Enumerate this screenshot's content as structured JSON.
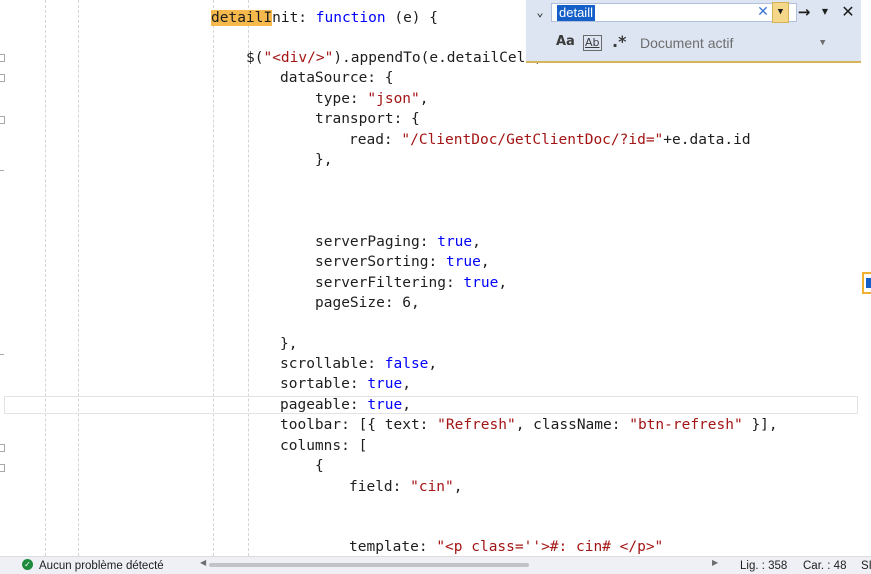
{
  "editor": {
    "lines": [
      {
        "indent": 0,
        "tokens": [
          {
            "t": "detailI",
            "c": "hl"
          },
          {
            "t": "nit: "
          },
          {
            "t": "function",
            "c": "kw"
          },
          {
            "t": " (e) {"
          }
        ]
      },
      {
        "indent": 1,
        "tokens": [
          {
            "t": "$("
          },
          {
            "t": "\"<div/>\"",
            "c": "str"
          },
          {
            "t": ").appendTo(e.detailCell)"
          }
        ]
      },
      {
        "indent": 2,
        "tokens": [
          {
            "t": "dataSource: {"
          }
        ]
      },
      {
        "indent": 3,
        "tokens": [
          {
            "t": "type: "
          },
          {
            "t": "\"json\"",
            "c": "str"
          },
          {
            "t": ","
          }
        ]
      },
      {
        "indent": 3,
        "tokens": [
          {
            "t": "transport: {"
          }
        ]
      },
      {
        "indent": 4,
        "tokens": [
          {
            "t": "read: "
          },
          {
            "t": "\"/ClientDoc/GetClientDoc/?id=\"",
            "c": "str"
          },
          {
            "t": "+e.data.id"
          }
        ]
      },
      {
        "indent": 3,
        "tokens": [
          {
            "t": "},"
          }
        ]
      },
      {
        "indent": 3,
        "tokens": [
          {
            "t": "serverPaging: "
          },
          {
            "t": "true",
            "c": "kw"
          },
          {
            "t": ","
          }
        ]
      },
      {
        "indent": 3,
        "tokens": [
          {
            "t": "serverSorting: "
          },
          {
            "t": "true",
            "c": "kw"
          },
          {
            "t": ","
          }
        ]
      },
      {
        "indent": 3,
        "tokens": [
          {
            "t": "serverFiltering: "
          },
          {
            "t": "true",
            "c": "kw"
          },
          {
            "t": ","
          }
        ]
      },
      {
        "indent": 3,
        "tokens": [
          {
            "t": "pageSize: 6,"
          }
        ]
      },
      {
        "indent": 2,
        "tokens": [
          {
            "t": "},"
          }
        ]
      },
      {
        "indent": 2,
        "tokens": [
          {
            "t": "scrollable: "
          },
          {
            "t": "false",
            "c": "kw"
          },
          {
            "t": ","
          }
        ]
      },
      {
        "indent": 2,
        "tokens": [
          {
            "t": "sortable: "
          },
          {
            "t": "true",
            "c": "kw"
          },
          {
            "t": ","
          }
        ]
      },
      {
        "indent": 2,
        "tokens": [
          {
            "t": "pageable: "
          },
          {
            "t": "true",
            "c": "kw"
          },
          {
            "t": ","
          }
        ]
      },
      {
        "indent": 2,
        "tokens": [
          {
            "t": "toolbar: [{ text: "
          },
          {
            "t": "\"Refresh\"",
            "c": "str"
          },
          {
            "t": ", className: "
          },
          {
            "t": "\"btn-refresh\"",
            "c": "str"
          },
          {
            "t": " }],"
          }
        ]
      },
      {
        "indent": 2,
        "tokens": [
          {
            "t": "columns: ["
          }
        ]
      },
      {
        "indent": 3,
        "tokens": [
          {
            "t": "{"
          }
        ]
      },
      {
        "indent": 4,
        "tokens": [
          {
            "t": "field: "
          },
          {
            "t": "\"cin\"",
            "c": "str"
          },
          {
            "t": ","
          }
        ]
      },
      {
        "indent": 4,
        "tokens": [
          {
            "t": "template: "
          },
          {
            "t": "\"<p class=''>#: cin# </p>\"",
            "c": "str"
          }
        ]
      }
    ]
  },
  "find": {
    "query": "detaill",
    "clear_icon": "close-icon",
    "options": {
      "match_case": "Aa",
      "whole_word": "Ab"
    },
    "scope": "Document actif"
  },
  "status": {
    "problems": "Aucun problème détecté",
    "line": "Lig. : 358",
    "col": "Car. : 48",
    "mode": "SI"
  },
  "colors": {
    "keyword": "#0000ff",
    "string": "#a31515",
    "match_highlight": "#f6b94c",
    "selection": "#1560c8"
  }
}
